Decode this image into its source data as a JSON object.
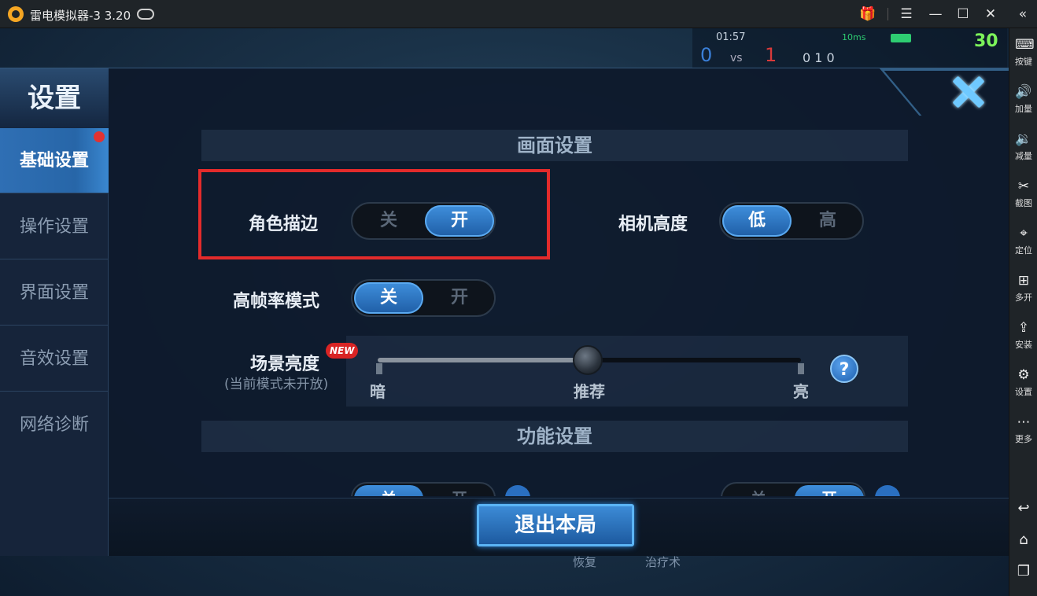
{
  "titlebar": {
    "title": "雷电模拟器-3 3.20",
    "icons": {
      "logo": "app-logo-icon",
      "gamepad": "gamepad-icon",
      "gift": "gift-icon",
      "menu": "menu-icon",
      "minimize": "minimize-icon",
      "maximize": "maximize-icon",
      "close": "close-icon",
      "collapse": "double-chevron-left-icon"
    },
    "gift_color": "#e03b3b"
  },
  "sidebar": {
    "items": [
      {
        "label": "按键",
        "icon": "keyboard-icon"
      },
      {
        "label": "加量",
        "icon": "volume-up-icon"
      },
      {
        "label": "减量",
        "icon": "volume-down-icon"
      },
      {
        "label": "截图",
        "icon": "scissors-icon"
      },
      {
        "label": "定位",
        "icon": "location-pin-icon"
      },
      {
        "label": "多开",
        "icon": "multi-window-icon"
      },
      {
        "label": "安装",
        "icon": "apk-install-icon"
      },
      {
        "label": "设置",
        "icon": "gear-icon"
      },
      {
        "label": "更多",
        "icon": "more-dots-icon"
      }
    ],
    "bottom": {
      "back": "back-icon",
      "home": "home-icon",
      "recent": "recent-apps-icon"
    }
  },
  "hud": {
    "timer": "01:57",
    "ping": "10ms",
    "score_blue": "0",
    "vs": "vs",
    "score_red": "1",
    "kda": "0  1  0",
    "fps": "30"
  },
  "settings": {
    "title": "设置",
    "nav": [
      {
        "label": "基础设置",
        "active": true,
        "badge": true
      },
      {
        "label": "操作设置",
        "active": false
      },
      {
        "label": "界面设置",
        "active": false
      },
      {
        "label": "音效设置",
        "active": false
      },
      {
        "label": "网络诊断",
        "active": false
      }
    ],
    "section_display": "画面设置",
    "section_function": "功能设置",
    "outline": {
      "label": "角色描边",
      "off": "关",
      "on": "开",
      "value": "开"
    },
    "camera_height": {
      "label": "相机高度",
      "low": "低",
      "high": "高",
      "value": "低"
    },
    "high_fps": {
      "label": "高帧率模式",
      "off": "关",
      "on": "开",
      "value": "关"
    },
    "brightness": {
      "label": "场景亮度",
      "sublabel": "(当前模式未开放)",
      "badge": "NEW",
      "min_label": "暗",
      "mid_label": "推荐",
      "max_label": "亮",
      "value": 0.5,
      "help": "?"
    },
    "clipped_row": {
      "toggle1": {
        "off": "关",
        "on": "开",
        "value": "关"
      },
      "toggle2": {
        "off": "关",
        "on": "开",
        "value": "开"
      }
    },
    "exit_label": "退出本局",
    "bg_skills": [
      "恢复",
      "治疗术"
    ],
    "colors": {
      "accent_blue": "#2f6fb4",
      "highlight_red": "#e32b2b",
      "badge_red": "#d92424"
    }
  }
}
